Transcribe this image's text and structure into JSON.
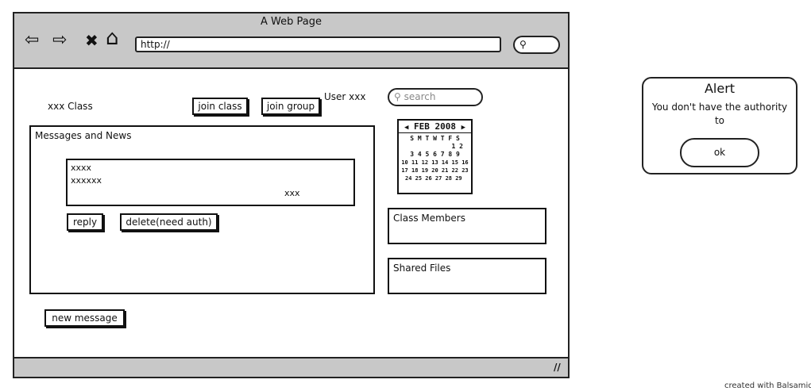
{
  "browser": {
    "title": "A Web Page",
    "url": "http://",
    "back_icon": "⇦",
    "forward_icon": "⇨",
    "stop_icon": "✖",
    "home_icon": "⌂",
    "search_icon": "⚲",
    "grip_icon": "//"
  },
  "page": {
    "class_label": "xxx Class",
    "join_class_label": "join class",
    "join_group_label": "join group",
    "user_label": "User xxx",
    "search_placeholder": "search"
  },
  "messages": {
    "title": "Messages and News",
    "line1": "xxxx",
    "line2": "xxxxxx",
    "line3": "xxx",
    "reply_label": "reply",
    "delete_label": "delete(need auth)",
    "new_message_label": "new message"
  },
  "calendar": {
    "month_label": "FEB 2008",
    "prev_icon": "◀",
    "next_icon": "▶",
    "weekdays": "S M T W T F S",
    "rows": [
      "1 2",
      "3 4 5 6 7 8 9",
      "10 11 12 13 14 15 16",
      "17 18 19 20 21 22 23",
      "24 25 26 27 28 29"
    ]
  },
  "sidebar": {
    "class_members_title": "Class Members",
    "shared_files_title": "Shared Files"
  },
  "alert": {
    "title": "Alert",
    "message": "You don't have the authority to",
    "ok_label": "ok"
  },
  "footer": {
    "credit": "created with Balsamiq M"
  }
}
